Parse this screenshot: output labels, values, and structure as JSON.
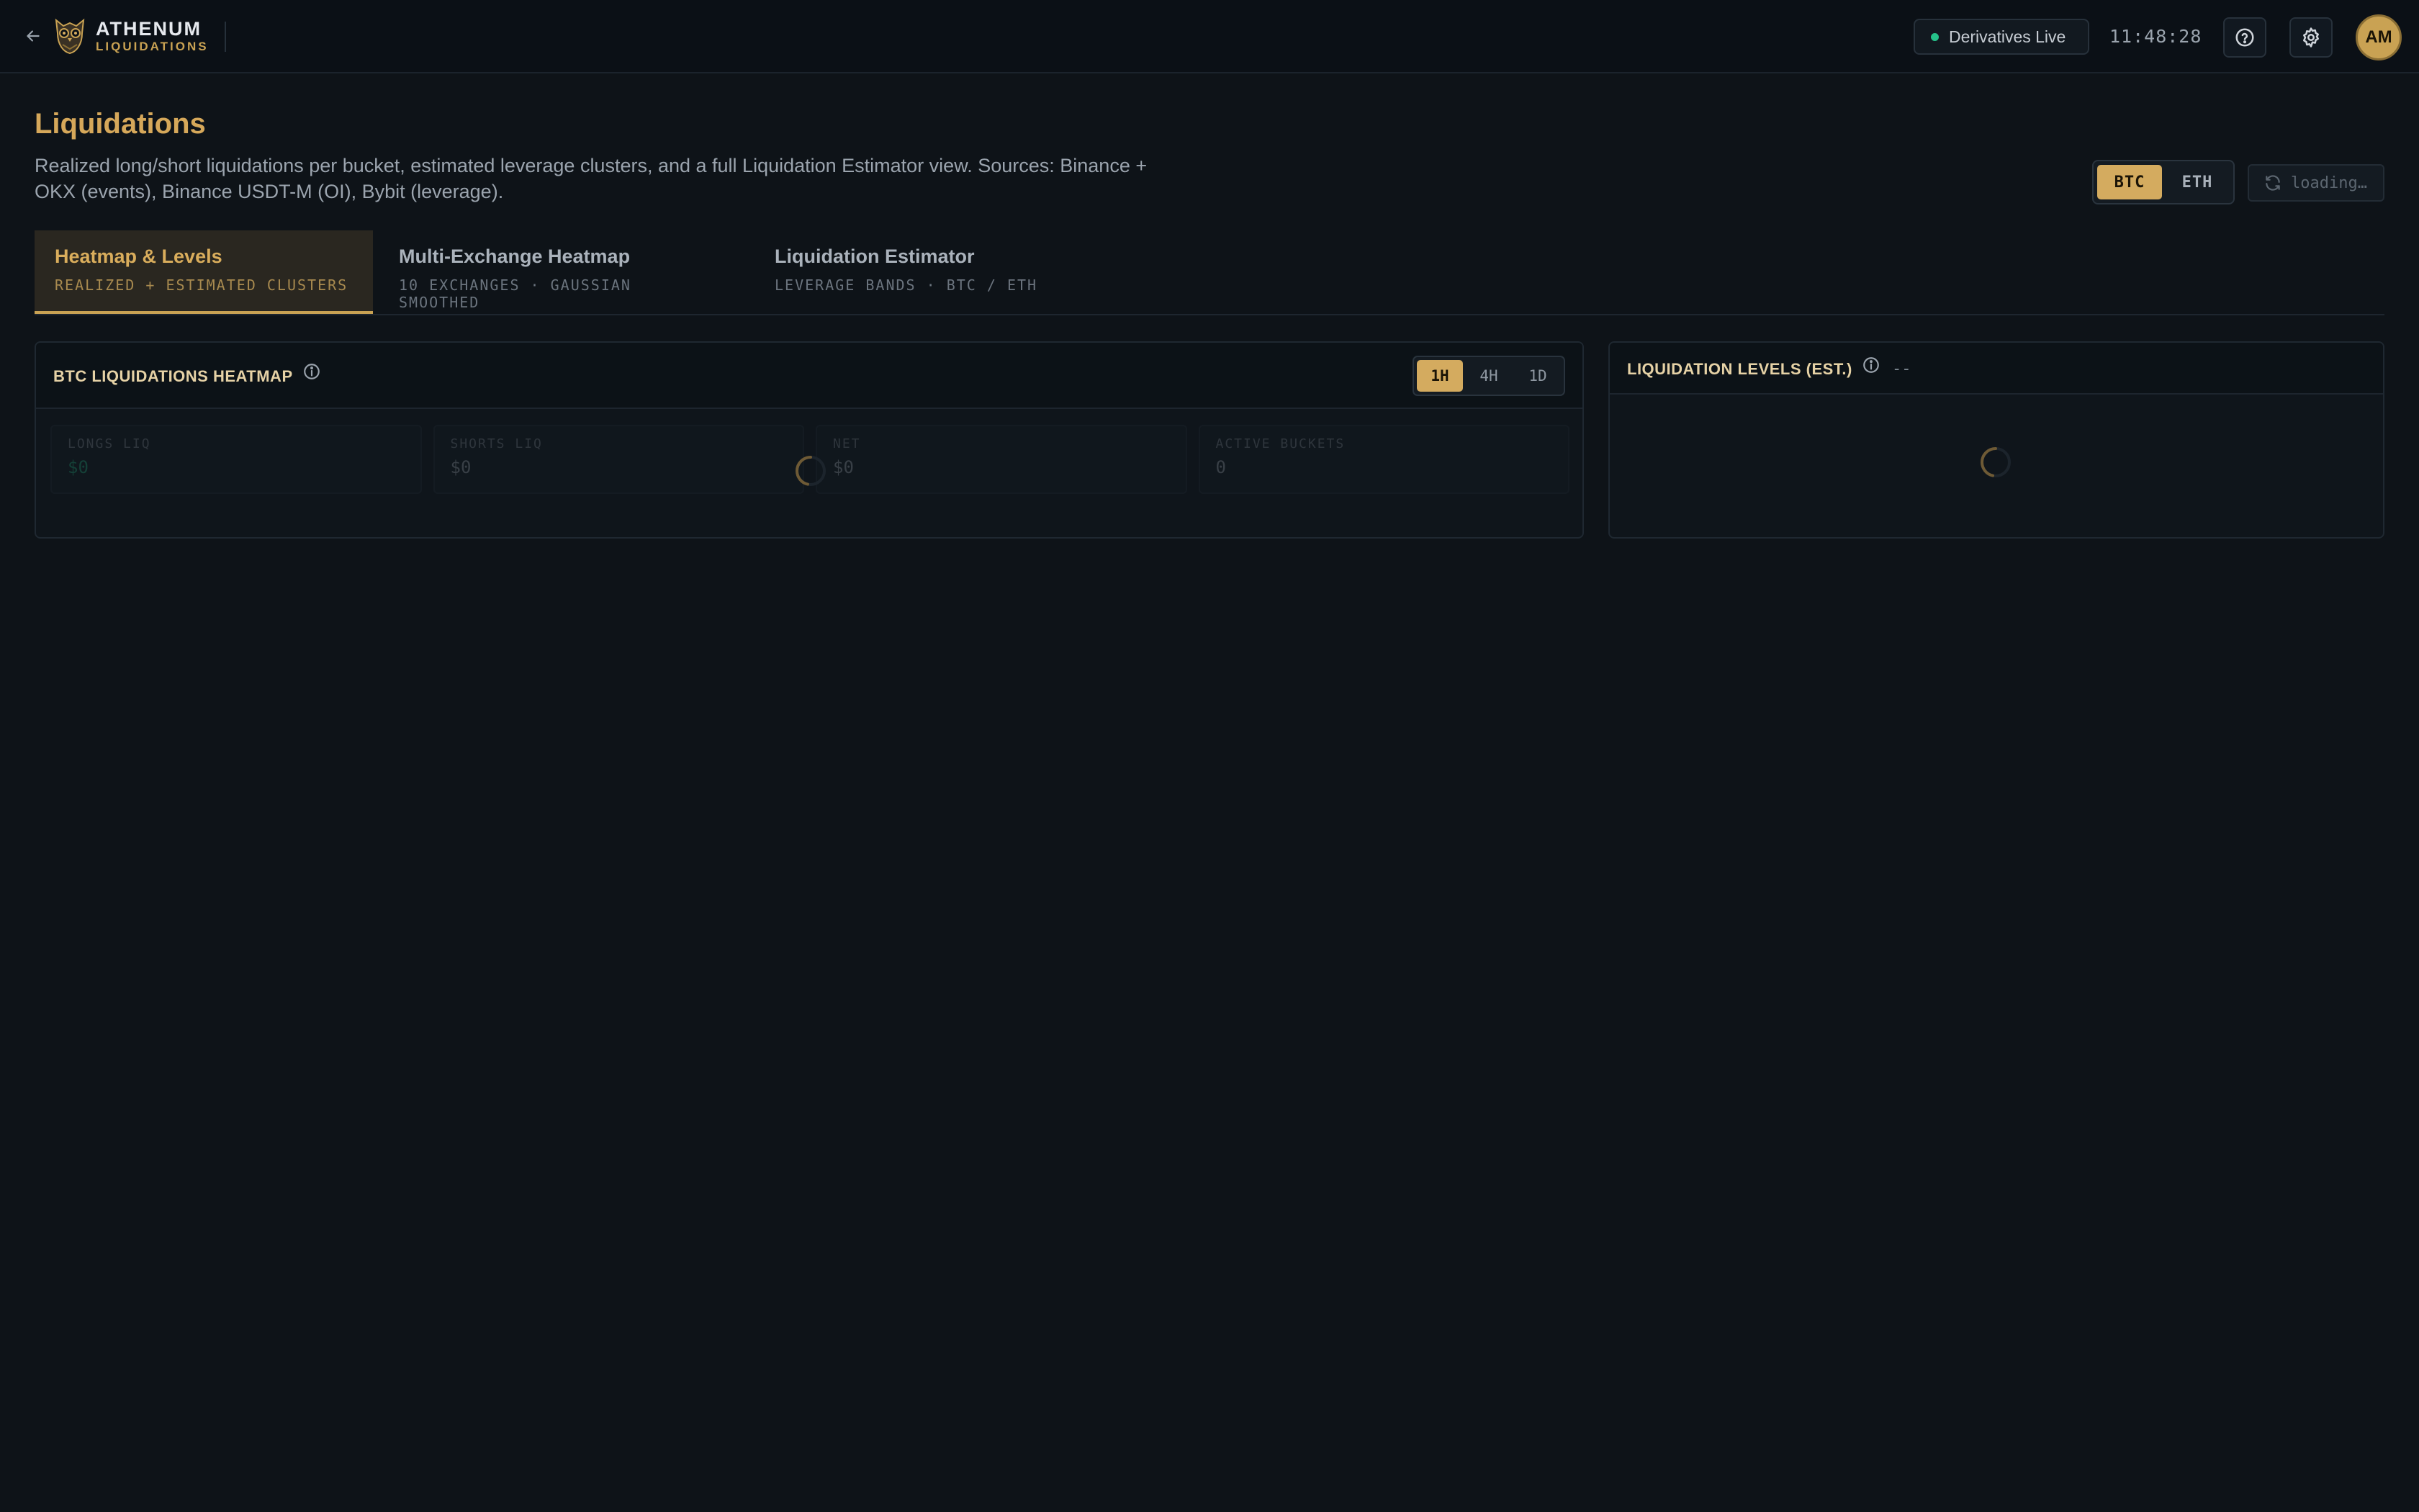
{
  "topbar": {
    "brand_name": "ATHENUM",
    "brand_sub": "LIQUIDATIONS",
    "live_status": "Derivatives Live",
    "clock": "11:48:28",
    "avatar_initials": "AM"
  },
  "header": {
    "title": "Liquidations",
    "description": "Realized long/short liquidations per bucket, estimated leverage clusters, and a full Liquidation Estimator view. Sources: Binance + OKX (events), Binance USDT-M (OI), Bybit (leverage).",
    "asset_options": [
      "BTC",
      "ETH"
    ],
    "asset_selected": "BTC",
    "refresh_label": "loading…"
  },
  "tabs": [
    {
      "label": "Heatmap & Levels",
      "sub": "REALIZED + ESTIMATED CLUSTERS",
      "active": true
    },
    {
      "label": "Multi-Exchange Heatmap",
      "sub": "10 EXCHANGES · GAUSSIAN SMOOTHED",
      "active": false
    },
    {
      "label": "Liquidation Estimator",
      "sub": "LEVERAGE BANDS · BTC / ETH",
      "active": false
    }
  ],
  "heatmap_panel": {
    "title": "BTC LIQUIDATIONS HEATMAP",
    "timeframes": [
      "1H",
      "4H",
      "1D"
    ],
    "timeframe_selected": "1H",
    "stats": [
      {
        "label": "LONGS LIQ",
        "value": "$0"
      },
      {
        "label": "SHORTS LIQ",
        "value": "$0"
      },
      {
        "label": "NET",
        "value": "$0"
      },
      {
        "label": "ACTIVE BUCKETS",
        "value": "0"
      }
    ]
  },
  "levels_panel": {
    "title": "LIQUIDATION LEVELS (EST.)",
    "value": "--"
  },
  "colors": {
    "accent": "#d4ab5f",
    "live_dot": "#25c28a",
    "background": "#0e1318"
  }
}
